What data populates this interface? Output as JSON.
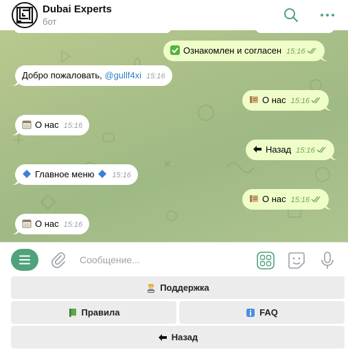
{
  "header": {
    "title": "Dubai Experts",
    "subtitle": "бот"
  },
  "messages": [
    {
      "dir": "out",
      "emoji": "check",
      "text": "Ознакомлен и согласен",
      "time": "15:16"
    },
    {
      "dir": "in",
      "text": "Добро пожаловать, ",
      "mention": "@gullf4xi",
      "time": "15:16"
    },
    {
      "dir": "out",
      "emoji": "scroll",
      "text": "О нас",
      "time": "15:16"
    },
    {
      "dir": "in",
      "emoji": "calendar",
      "text": "О нас",
      "time": "15:16"
    },
    {
      "dir": "out",
      "emoji": "back-arrow",
      "text": "Назад",
      "time": "15:16"
    },
    {
      "dir": "in",
      "emoji": "diamond",
      "text": "Главное меню",
      "time": "15:16"
    },
    {
      "dir": "out",
      "emoji": "scroll",
      "text": "О нас",
      "time": "15:16"
    },
    {
      "dir": "in",
      "emoji": "calendar",
      "text": "О нас",
      "time": "15:16"
    }
  ],
  "input": {
    "placeholder": "Сообщение..."
  },
  "keyboard": [
    {
      "label": "Поддержка",
      "emoji": "technician"
    },
    {
      "label": "Правила",
      "emoji": "green-book"
    },
    {
      "label": "FAQ",
      "emoji": "info"
    },
    {
      "label": "Назад",
      "emoji": "back-arrow"
    }
  ],
  "colors": {
    "accent": "#4fa27a",
    "outgoing_bubble": "#effdc8",
    "link": "#2f7fc9"
  }
}
